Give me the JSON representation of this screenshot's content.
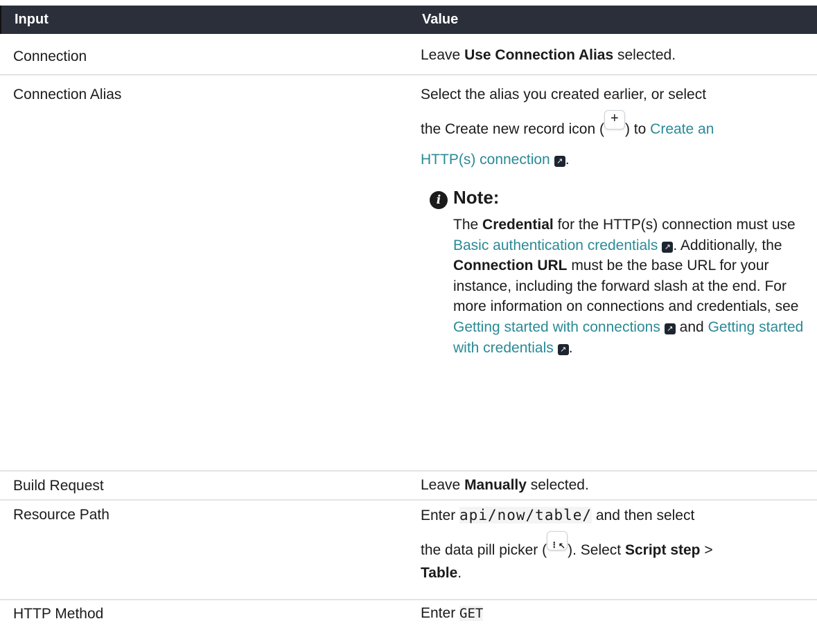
{
  "header": {
    "col1": "Input",
    "col2": "Value"
  },
  "rows": {
    "connection": {
      "input": "Connection",
      "v_pre": "Leave ",
      "v_bold": "Use Connection Alias",
      "v_post": " selected."
    },
    "alias": {
      "input": "Connection Alias",
      "line1": "Select the alias you created earlier, or select",
      "line2_pre": "the Create new record icon (",
      "plus_glyph": "+",
      "line2_post": ") to ",
      "link1a": "Create an",
      "link1b": "HTTP(s) connection",
      "period": ".",
      "note": {
        "title": "Note:",
        "t1": "The ",
        "credential": "Credential",
        "t2": " for the HTTP(s) connection must use ",
        "link_basic": "Basic authentication credentials",
        "t3": ". Additionally, the ",
        "conn_url": "Connection URL",
        "t4": " must be the base URL for your instance, including the forward slash at the end. For more information on connections and credentials, see ",
        "link_conn": "Getting started with connections",
        "t5": " and ",
        "link_cred": "Getting started with credentials",
        "t6": "."
      }
    },
    "build": {
      "input": "Build Request",
      "v_pre": "Leave ",
      "v_bold": "Manually",
      "v_post": " selected."
    },
    "resource": {
      "input": "Resource Path",
      "pre": "Enter ",
      "code": "api/now/table/",
      "mid": " and then select",
      "line2_pre": "the data pill picker (",
      "pill_glyph": "⠇↖",
      "line2_post": "). Select ",
      "bold1": "Script step",
      "sep": " >",
      "bold2": "Table",
      "end": "."
    },
    "method": {
      "input": "HTTP Method",
      "pre": "Enter ",
      "code": "GET"
    }
  },
  "icons": {
    "external_link": "external-link-icon",
    "note": "info-icon"
  }
}
